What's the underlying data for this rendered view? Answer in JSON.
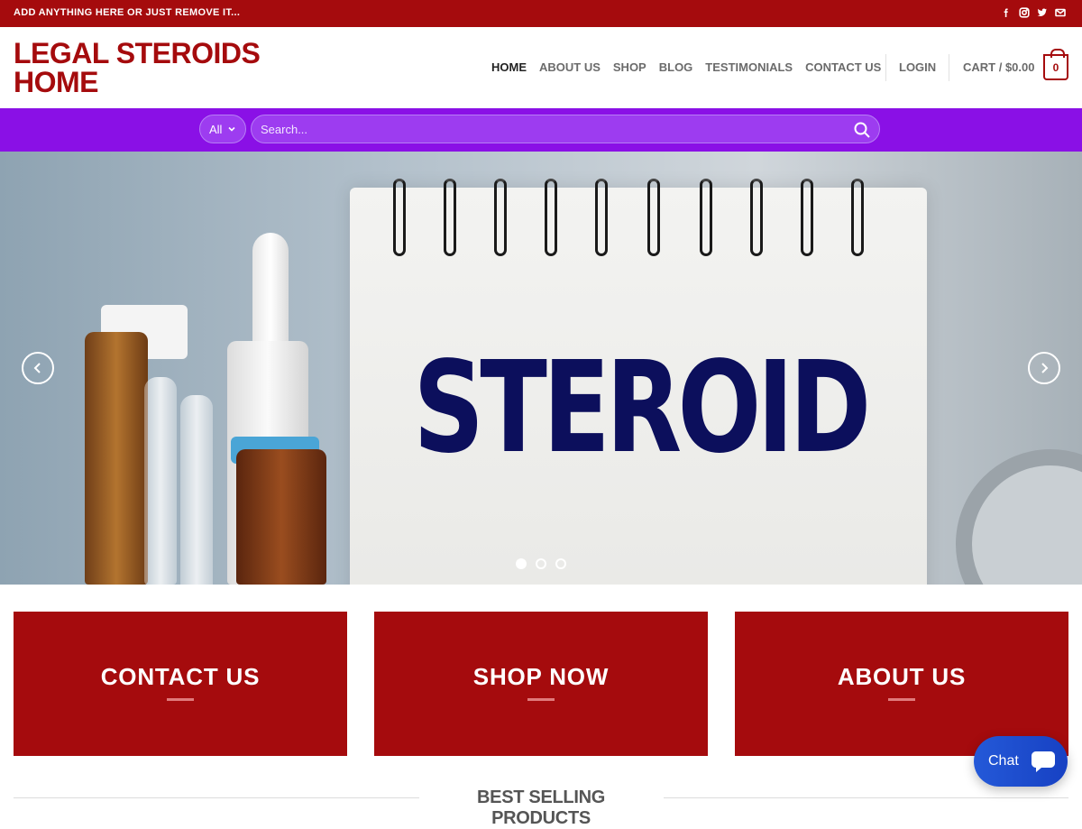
{
  "topbar": {
    "message": "ADD ANYTHING HERE OR JUST REMOVE IT...",
    "social_icons": [
      "facebook-icon",
      "instagram-icon",
      "twitter-icon",
      "email-icon"
    ]
  },
  "header": {
    "logo_line1": "LEGAL STEROIDS",
    "logo_line2": "HOME",
    "nav": [
      "HOME",
      "ABOUT US",
      "SHOP",
      "BLOG",
      "TESTIMONIALS",
      "CONTACT US"
    ],
    "login": "LOGIN",
    "cart_label": "CART / $0.00",
    "cart_count": "0"
  },
  "search": {
    "category": "All",
    "placeholder": "Search..."
  },
  "hero": {
    "word": "STEROID",
    "slide_count": 3,
    "active_slide": 1
  },
  "cards": [
    {
      "title": "CONTACT US"
    },
    {
      "title": "SHOP NOW"
    },
    {
      "title": "ABOUT US"
    }
  ],
  "section": {
    "title": "BEST SELLING PRODUCTS"
  },
  "chat": {
    "label": "Chat"
  },
  "colors": {
    "brand_red": "#a50b0d",
    "search_purple": "#8a10e6",
    "chat_blue": "#2459d8"
  }
}
